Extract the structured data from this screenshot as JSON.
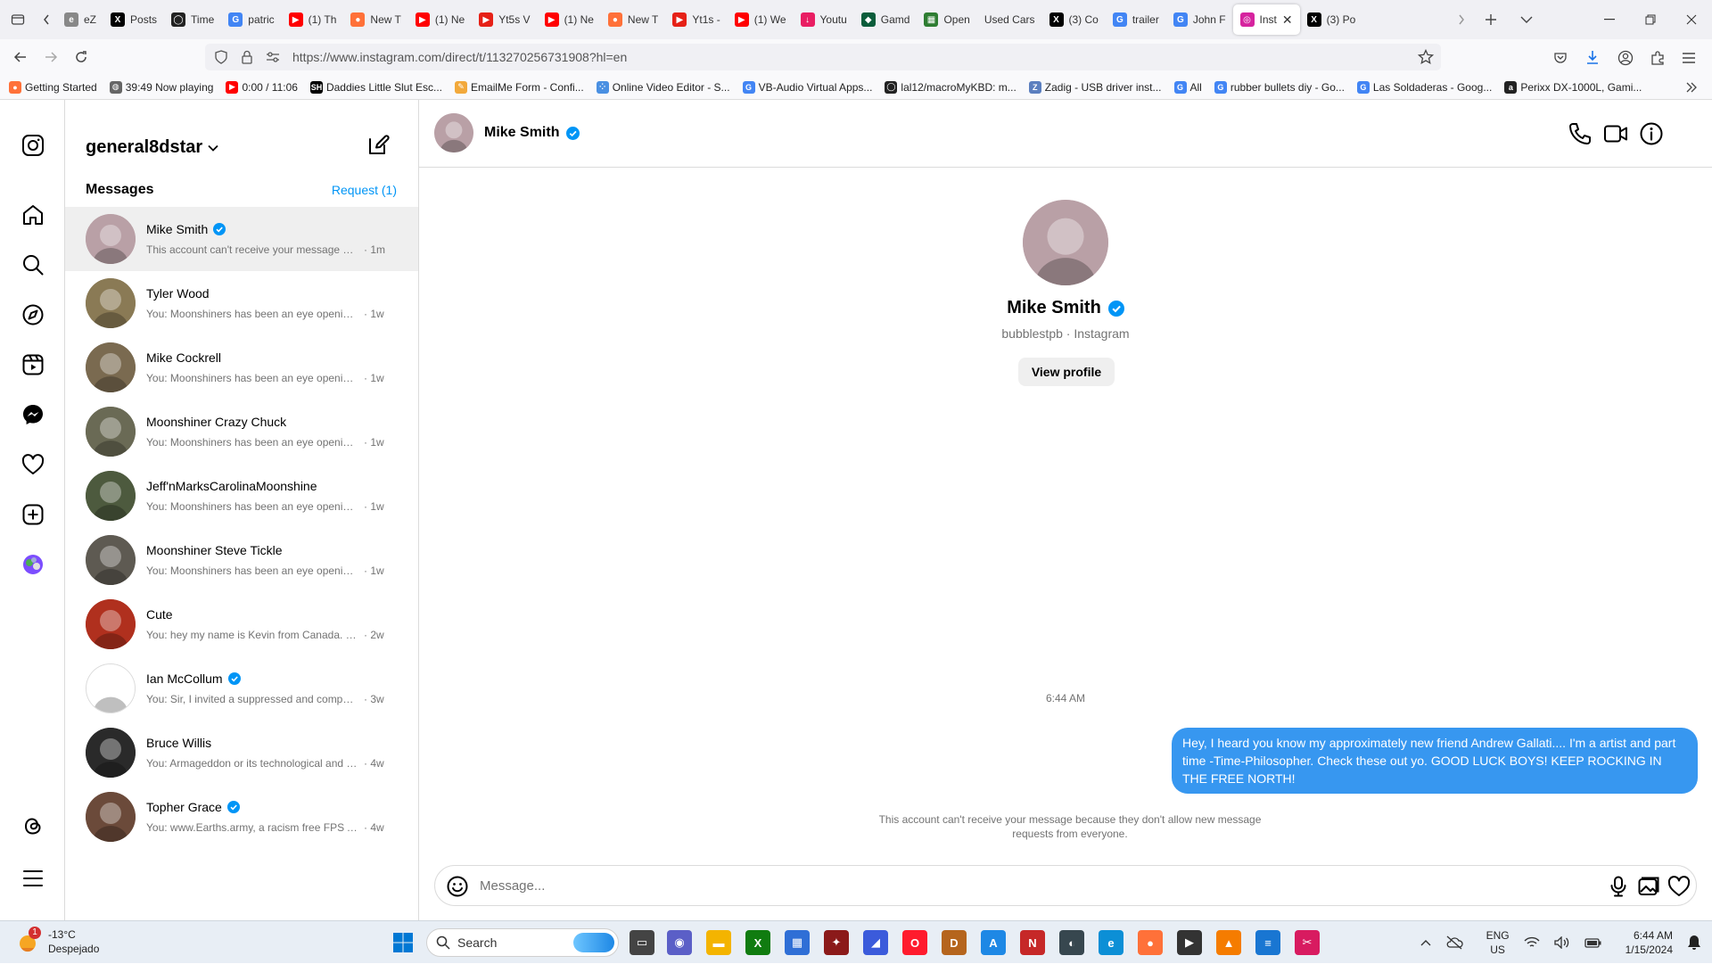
{
  "browser": {
    "tabs": [
      {
        "label": "eZ",
        "icon": "ez-icon",
        "color": "#888888"
      },
      {
        "label": "Posts",
        "icon": "x-icon",
        "color": "#000000"
      },
      {
        "label": "Time",
        "icon": "github-icon",
        "color": "#222222"
      },
      {
        "label": "patric",
        "icon": "google-icon",
        "color": "#4285f4"
      },
      {
        "label": "(1) Th",
        "icon": "youtube-icon",
        "color": "#ff0000"
      },
      {
        "label": "New T",
        "icon": "firefox-icon",
        "color": "#ff7139"
      },
      {
        "label": "(1) Ne",
        "icon": "youtube-icon",
        "color": "#ff0000"
      },
      {
        "label": "Yt5s V",
        "icon": "yt5s-icon",
        "color": "#e62117"
      },
      {
        "label": "(1) Ne",
        "icon": "youtube-icon",
        "color": "#ff0000"
      },
      {
        "label": "New T",
        "icon": "firefox-icon",
        "color": "#ff7139"
      },
      {
        "label": "Yt1s -",
        "icon": "yt1s-icon",
        "color": "#e62117"
      },
      {
        "label": "(1) We",
        "icon": "youtube-icon",
        "color": "#ff0000"
      },
      {
        "label": "Youtu",
        "icon": "download-icon",
        "color": "#e91e63"
      },
      {
        "label": "Gamd",
        "icon": "gamd-icon",
        "color": "#0b5d3b"
      },
      {
        "label": "Open",
        "icon": "open-icon",
        "color": "#2e7d32"
      },
      {
        "label": "Used Cars",
        "icon": "",
        "color": "#f0f0f4"
      },
      {
        "label": "(3) Co",
        "icon": "x-icon",
        "color": "#000000"
      },
      {
        "label": "trailer",
        "icon": "google-icon",
        "color": "#4285f4"
      },
      {
        "label": "John F",
        "icon": "google-icon",
        "color": "#4285f4"
      },
      {
        "label": "Inst",
        "icon": "instagram-icon",
        "color": "#d6249f",
        "active": true
      },
      {
        "label": "(3) Po",
        "icon": "x-icon",
        "color": "#000000"
      }
    ],
    "url": "https://www.instagram.com/direct/t/113270256731908?hl=en",
    "bookmarks": [
      {
        "label": "Getting Started",
        "icon": "firefox-icon",
        "color": "#ff7139"
      },
      {
        "label": "39:49  Now playing",
        "icon": "globe-icon",
        "color": "#666666"
      },
      {
        "label": "0:00 / 11:06",
        "icon": "youtube-icon",
        "color": "#ff0000"
      },
      {
        "label": "Daddies Little Slut Esc...",
        "icon": "sh-icon",
        "color": "#000000"
      },
      {
        "label": "EmailMe Form - Confi...",
        "icon": "pen-icon",
        "color": "#f2a93b"
      },
      {
        "label": "Online Video Editor - S...",
        "icon": "dots-icon",
        "color": "#4a90e2"
      },
      {
        "label": "VB-Audio Virtual Apps...",
        "icon": "google-icon",
        "color": "#4285f4"
      },
      {
        "label": "lal12/macroMyKBD: m...",
        "icon": "github-icon",
        "color": "#222222"
      },
      {
        "label": "Zadig - USB driver inst...",
        "icon": "zadig-icon",
        "color": "#5b7fbf"
      },
      {
        "label": "All",
        "icon": "google-icon",
        "color": "#4285f4"
      },
      {
        "label": "rubber bullets diy - Go...",
        "icon": "google-icon",
        "color": "#4285f4"
      },
      {
        "label": "Las Soldaderas - Goog...",
        "icon": "google-icon",
        "color": "#4285f4"
      },
      {
        "label": "Perixx DX-1000L, Gami...",
        "icon": "amazon-icon",
        "color": "#222222"
      }
    ]
  },
  "instagram": {
    "account": "general8dstar",
    "messages_label": "Messages",
    "requests_label": "Request (1)",
    "conversations": [
      {
        "name": "Mike Smith",
        "verified": true,
        "preview": "This account can't receive your message be...",
        "time": "· 1m",
        "selected": true,
        "avatar_color": "#b9a0a6"
      },
      {
        "name": "Tyler Wood",
        "verified": false,
        "preview": "You: Moonshiners has been an eye opening ...",
        "time": "· 1w",
        "avatar_color": "#8a7a55"
      },
      {
        "name": "Mike Cockrell",
        "verified": false,
        "preview": "You: Moonshiners has been an eye opening ...",
        "time": "· 1w",
        "avatar_color": "#7a6a50"
      },
      {
        "name": "Moonshiner Crazy Chuck",
        "verified": false,
        "preview": "You: Moonshiners has been an eye opening ...",
        "time": "· 1w",
        "avatar_color": "#6a6a55"
      },
      {
        "name": "Jeff'nMarksCarolinaMoonshine",
        "verified": false,
        "preview": "You: Moonshiners has been an eye opening ...",
        "time": "· 1w",
        "avatar_color": "#4d5a3e"
      },
      {
        "name": "Moonshiner Steve Tickle",
        "verified": false,
        "preview": "You: Moonshiners has been an eye opening ...",
        "time": "· 1w",
        "avatar_color": "#5e5a52"
      },
      {
        "name": "Cute",
        "verified": false,
        "preview": "You: hey my name is Kevin from Canada. W...",
        "time": "· 2w",
        "avatar_color": "#b0301e"
      },
      {
        "name": "Ian McCollum",
        "verified": true,
        "preview": "You: Sir, I invited a suppressed and compens...",
        "time": "· 3w",
        "avatar_color": "#ffffff"
      },
      {
        "name": "Bruce Willis",
        "verified": false,
        "preview": "You: Armageddon or its technological and s...",
        "time": "· 4w",
        "avatar_color": "#2a2a2a"
      },
      {
        "name": "Topher Grace",
        "verified": true,
        "preview": "You: www.Earths.army, a racism free FPS AC...",
        "time": "· 4w",
        "avatar_color": "#6b4a3a"
      }
    ],
    "chat": {
      "name": "Mike Smith",
      "username_line": "bubblestpb · Instagram",
      "view_profile_label": "View profile",
      "timestamp": "6:44 AM",
      "sent_message": "Hey,   I heard you know my approximately new friend Andrew Gallati.... I'm a artist and part time -Time-Philosopher.  Check these out yo.  GOOD LUCK BOYS! KEEP ROCKING IN THE FREE NORTH!",
      "notice": "This account can't receive your message because they don't allow new message requests from everyone.",
      "input_placeholder": "Message...",
      "input_value": ""
    },
    "colors": {
      "accent": "#0095f6",
      "bubble": "#3797f0",
      "verified": "#0095f6"
    }
  },
  "taskbar": {
    "weather_temp": "-13°C",
    "weather_desc": "Despejado",
    "weather_badge": "1",
    "search_label": "Search",
    "lang_top": "ENG",
    "lang_bottom": "US",
    "time": "6:44 AM",
    "date": "1/15/2024",
    "pinned": [
      {
        "name": "task-view-icon",
        "color": "#444444",
        "glyph": "▭"
      },
      {
        "name": "teams-icon",
        "color": "#5b5fc7",
        "glyph": "◉"
      },
      {
        "name": "file-explorer-icon",
        "color": "#f4b400",
        "glyph": "▬"
      },
      {
        "name": "xbox-icon",
        "color": "#107c10",
        "glyph": "X"
      },
      {
        "name": "store-icon",
        "color": "#2f6fd6",
        "glyph": "▦"
      },
      {
        "name": "game-icon",
        "color": "#8b1a1a",
        "glyph": "✦"
      },
      {
        "name": "vector-app-icon",
        "color": "#3b5bdb",
        "glyph": "◢"
      },
      {
        "name": "opera-icon",
        "color": "#ff1b2d",
        "glyph": "O"
      },
      {
        "name": "dos-icon",
        "color": "#b5651d",
        "glyph": "D"
      },
      {
        "name": "affinity-icon",
        "color": "#1e88e5",
        "glyph": "A"
      },
      {
        "name": "nch-icon",
        "color": "#c62828",
        "glyph": "N"
      },
      {
        "name": "disc-app-icon",
        "color": "#37474f",
        "glyph": "◐"
      },
      {
        "name": "edge-icon",
        "color": "#0c8fd6",
        "glyph": "e"
      },
      {
        "name": "firefox-icon",
        "color": "#ff7139",
        "glyph": "●"
      },
      {
        "name": "media-player-icon",
        "color": "#333333",
        "glyph": "▶"
      },
      {
        "name": "vlc-icon",
        "color": "#f57c00",
        "glyph": "▲"
      },
      {
        "name": "notepad-icon",
        "color": "#1976d2",
        "glyph": "≡"
      },
      {
        "name": "snip-icon",
        "color": "#d81b60",
        "glyph": "✂"
      }
    ]
  }
}
